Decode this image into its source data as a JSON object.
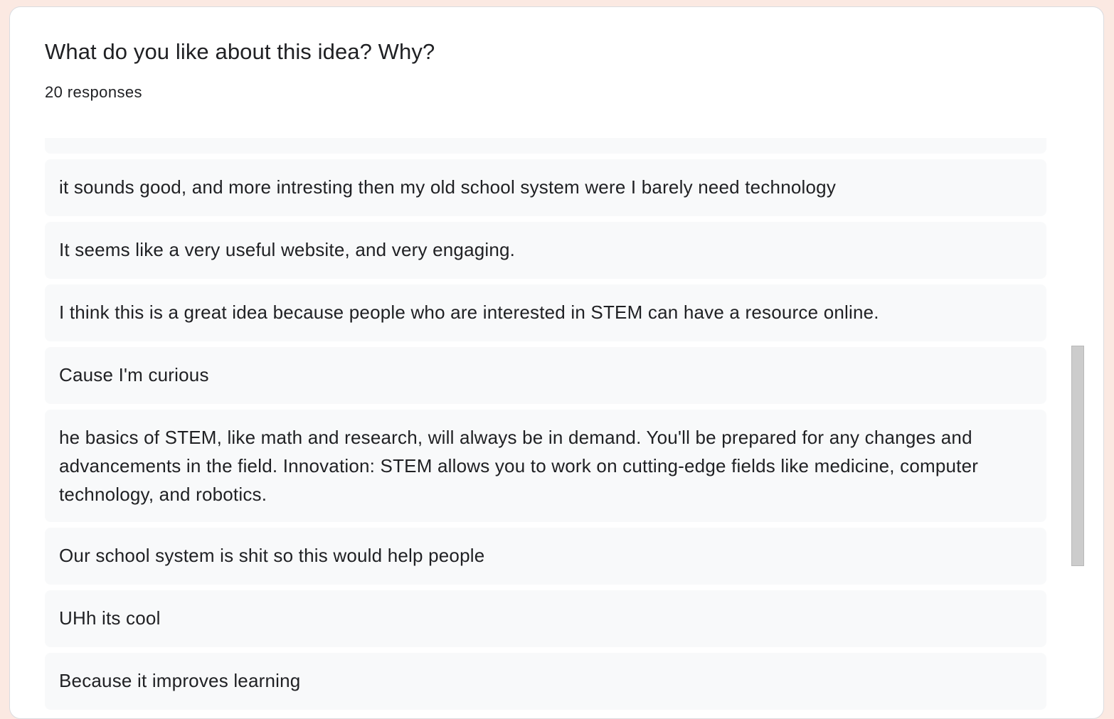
{
  "question": {
    "title": "What do you like about this idea? Why?",
    "response_count": "20 responses"
  },
  "responses": [
    "",
    "it sounds good, and more intresting then my old school system were I barely need technology",
    "It seems like a very useful website, and very engaging.",
    "I think this is a great idea because people who are interested in STEM can have a resource online.",
    "Cause I'm curious",
    "he basics of STEM, like math and research, will always be in demand. You'll be prepared for any changes and advancements in the field. Innovation: STEM allows you to work on cutting-edge fields like medicine, computer technology, and robotics.",
    "Our school system is shit so this would help people",
    "UHh its cool",
    "Because it improves learning"
  ],
  "scroll": {
    "position_fraction": 0.36,
    "visible_fraction": 0.38
  },
  "colors": {
    "page_background": "#fbe9e2",
    "card_background": "#ffffff",
    "response_background": "#f8f9fa",
    "text": "#202124",
    "scrollbar_thumb": "#cccccc"
  }
}
